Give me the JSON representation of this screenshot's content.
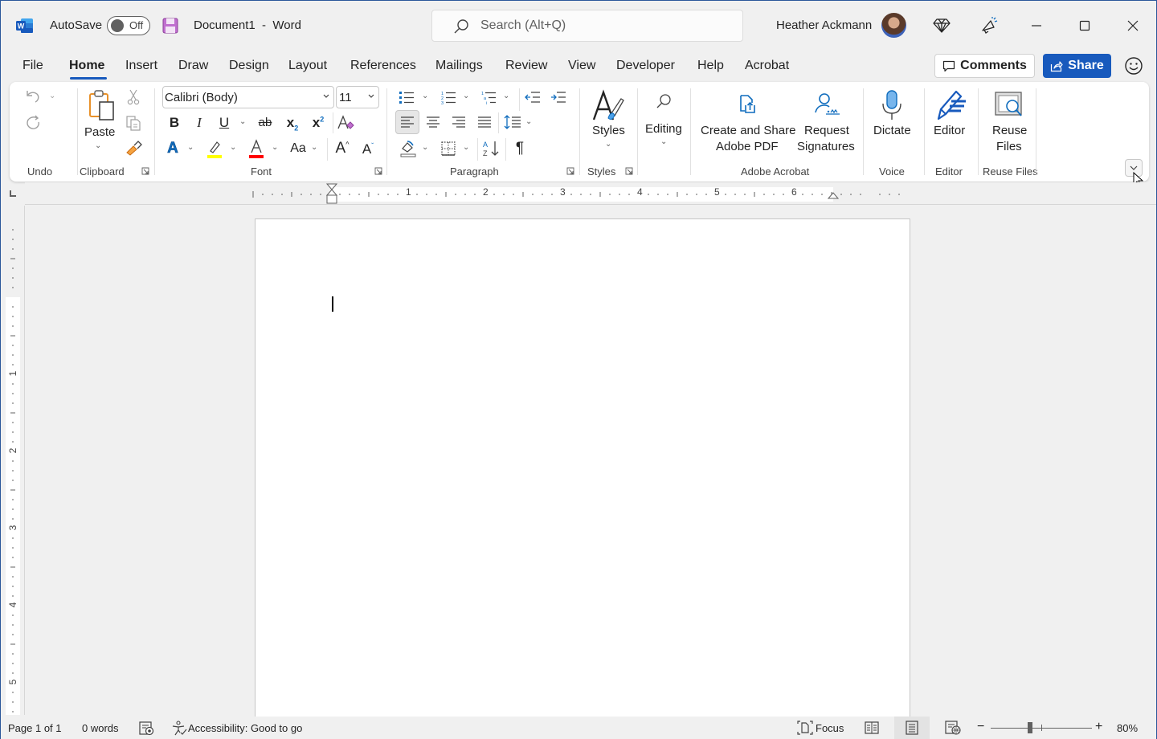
{
  "titlebar": {
    "autosave_label": "AutoSave",
    "autosave_state": "Off",
    "document_title": "Document1  -  Word",
    "search_placeholder": "Search (Alt+Q)",
    "user_name": "Heather Ackmann",
    "icons": [
      "word-logo-icon",
      "save-icon",
      "search-icon",
      "diamond-icon",
      "megaphone-icon",
      "minimize-icon",
      "maximize-icon",
      "close-icon"
    ]
  },
  "tabs": [
    {
      "label": "File",
      "active": false
    },
    {
      "label": "Home",
      "active": true
    },
    {
      "label": "Insert",
      "active": false
    },
    {
      "label": "Draw",
      "active": false
    },
    {
      "label": "Design",
      "active": false
    },
    {
      "label": "Layout",
      "active": false
    },
    {
      "label": "References",
      "active": false
    },
    {
      "label": "Mailings",
      "active": false
    },
    {
      "label": "Review",
      "active": false
    },
    {
      "label": "View",
      "active": false
    },
    {
      "label": "Developer",
      "active": false
    },
    {
      "label": "Help",
      "active": false
    },
    {
      "label": "Acrobat",
      "active": false
    }
  ],
  "header_actions": {
    "comments_label": "Comments",
    "share_label": "Share"
  },
  "ribbon": {
    "groups": {
      "undo": "Undo",
      "clipboard": "Clipboard",
      "font": "Font",
      "paragraph": "Paragraph",
      "styles": "Styles",
      "adobe_acrobat": "Adobe Acrobat",
      "voice": "Voice",
      "editor": "Editor",
      "reuse_files": "Reuse Files"
    },
    "paste_label": "Paste",
    "font_name": "Calibri (Body)",
    "font_size": "11",
    "styles_label": "Styles",
    "editing_label": "Editing",
    "create_share_pdf_label_1": "Create and Share",
    "create_share_pdf_label_2": "Adobe PDF",
    "request_signatures_label_1": "Request",
    "request_signatures_label_2": "Signatures",
    "dictate_label": "Dictate",
    "editor_label": "Editor",
    "reuse_files_label_1": "Reuse",
    "reuse_files_label_2": "Files",
    "font_glyphs": {
      "bold": "B",
      "italic": "I",
      "underline": "U",
      "strikethrough": "ab",
      "subscript": "x",
      "superscript": "x",
      "change_case": "Aa",
      "grow_font": "A",
      "shrink_font": "A",
      "pilcrow": "¶"
    },
    "colors": {
      "highlight": "#ffff00",
      "font_color": "#ff0000",
      "accent": "#185abd"
    }
  },
  "ruler": {
    "horizontal_numbers": [
      "1",
      "2",
      "3",
      "4",
      "5",
      "6"
    ],
    "vertical_numbers": [
      "1",
      "2",
      "3",
      "4",
      "5"
    ]
  },
  "statusbar": {
    "page_info": "Page 1 of 1",
    "word_count": "0 words",
    "accessibility": "Accessibility: Good to go",
    "focus_label": "Focus",
    "zoom_level": "80%",
    "zoom_percent": 80,
    "view_mode": "Print Layout"
  }
}
